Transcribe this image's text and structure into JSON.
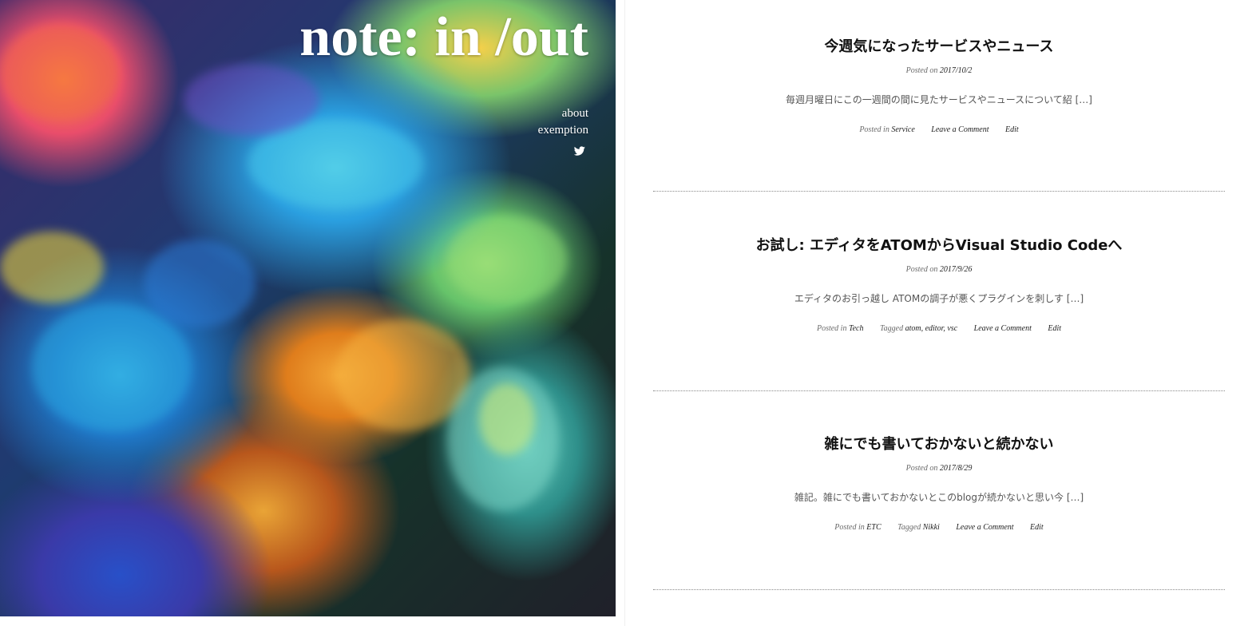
{
  "site": {
    "title": "note: in /out"
  },
  "nav": {
    "items": [
      {
        "label": "about"
      },
      {
        "label": "exemption"
      }
    ],
    "social_icon": "twitter-icon"
  },
  "hero": {
    "image_description_icon": "rainbow-roses-image"
  },
  "posts": [
    {
      "title": "今週気になったサービスやニュース",
      "posted_on_label": "Posted on",
      "date": "2017/10/2",
      "excerpt": "毎週月曜日にこの一週間の間に見たサービスやニュースについて紹 […]",
      "posted_in_label": "Posted in",
      "category": "Service",
      "tagged_label": "",
      "tags": "",
      "comment_label": "Leave a Comment",
      "edit_label": "Edit"
    },
    {
      "title": "お試し: エディタをATOMからVisual Studio Codeへ",
      "posted_on_label": "Posted on",
      "date": "2017/9/26",
      "excerpt": "エディタのお引っ越し ATOMの調子が悪くプラグインを刺しす […]",
      "posted_in_label": "Posted in",
      "category": "Tech",
      "tagged_label": "Tagged",
      "tags": "atom, editor, vsc",
      "comment_label": "Leave a Comment",
      "edit_label": "Edit"
    },
    {
      "title": "雑にでも書いておかないと続かない",
      "posted_on_label": "Posted on",
      "date": "2017/8/29",
      "excerpt": "雑記。雑にでも書いておかないとこのblogが続かないと思い今 […]",
      "posted_in_label": "Posted in",
      "category": "ETC",
      "tagged_label": "Tagged",
      "tags": "Nikki",
      "comment_label": "Leave a Comment",
      "edit_label": "Edit"
    }
  ]
}
